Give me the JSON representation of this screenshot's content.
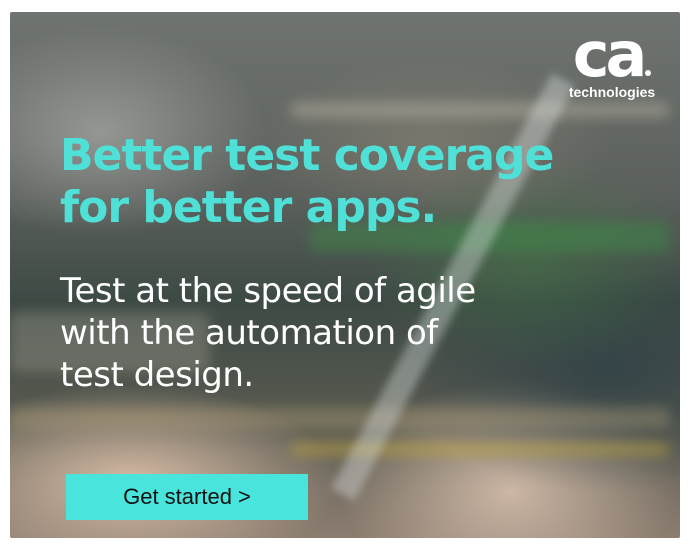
{
  "logo": {
    "mark": "ca",
    "subtitle": "technologies"
  },
  "headline": {
    "line1": "Better test coverage",
    "line2": "for better apps."
  },
  "subhead": {
    "line1": "Test at the speed of agile",
    "line2": "with the automation of",
    "line3": "test design."
  },
  "cta": {
    "label": "Get started >"
  },
  "colors": {
    "headline": "#4fe0d8",
    "cta_background": "#49e4dc",
    "text": "#ffffff"
  }
}
